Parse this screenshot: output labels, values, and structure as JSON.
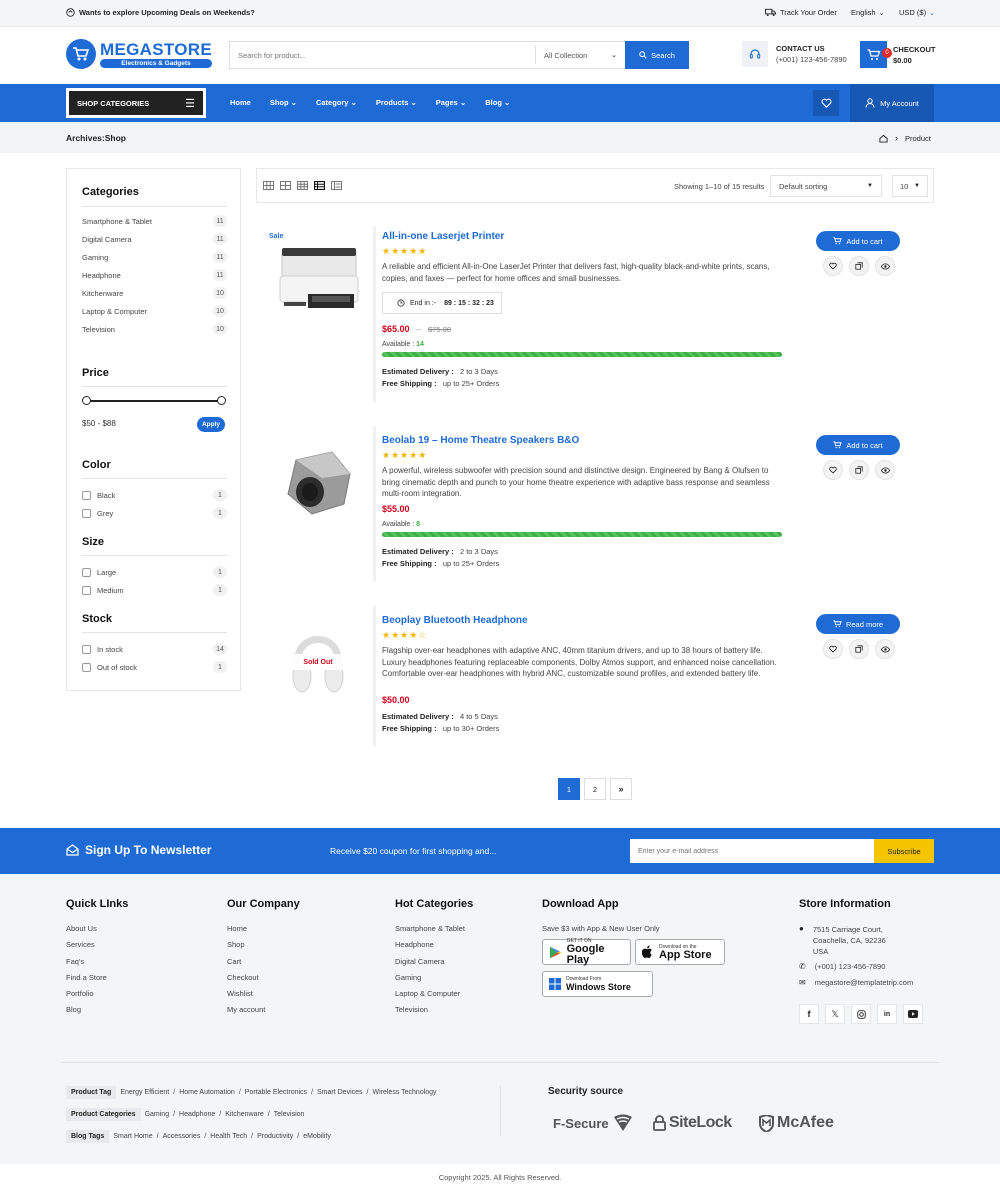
{
  "topbar": {
    "promo": "Wants to explore Upcoming Deals on Weekends?",
    "track": "Track Your Order",
    "language": "English",
    "currency": "USD ($)"
  },
  "header": {
    "logo_main_1": "MEGA",
    "logo_main_2": "STORE",
    "logo_sub": "Electronics & Gadgets",
    "search_placeholder": "Search for product...",
    "collection": "All Collection",
    "search_btn": "Search",
    "contact_label": "CONTACT US",
    "contact_phone": "(+001) 123-456-7890",
    "cart_count": "0",
    "checkout_label": "CHECKOUT",
    "checkout_total": "$0.00"
  },
  "nav": {
    "categories_btn": "SHOP CATEGORIES",
    "items": [
      "Home",
      "Shop",
      "Category",
      "Products",
      "Pages",
      "Blog"
    ],
    "account": "My Account"
  },
  "crumb": {
    "title": "Archives:Shop",
    "current": "Product"
  },
  "sidebar": {
    "categories_title": "Categories",
    "categories": [
      {
        "name": "Smartphone & Tablet",
        "count": "11"
      },
      {
        "name": "Digital Camera",
        "count": "11"
      },
      {
        "name": "Gaming",
        "count": "11"
      },
      {
        "name": "Headphone",
        "count": "11"
      },
      {
        "name": "Kitchenware",
        "count": "10"
      },
      {
        "name": "Laptop & Computer",
        "count": "10"
      },
      {
        "name": "Television",
        "count": "10"
      }
    ],
    "price_title": "Price",
    "price_range": "$50 - $88",
    "apply": "Apply",
    "price_slider": {
      "min": 50,
      "max": 88,
      "low": 50,
      "high": 88
    },
    "color_title": "Color",
    "colors": [
      {
        "name": "Black",
        "count": "1"
      },
      {
        "name": "Grey",
        "count": "1"
      }
    ],
    "size_title": "Size",
    "sizes": [
      {
        "name": "Large",
        "count": "1"
      },
      {
        "name": "Medium",
        "count": "1"
      }
    ],
    "stock_title": "Stock",
    "stock": [
      {
        "name": "In stock",
        "count": "14"
      },
      {
        "name": "Out of stock",
        "count": "1"
      }
    ]
  },
  "toolbar": {
    "results": "Showing 1–10 of 15 results",
    "sorting": "Default sorting",
    "per_page": "10"
  },
  "products": [
    {
      "badge": "Sale",
      "title": "All-in-one Laserjet Printer",
      "rating": 5,
      "desc": "A reliable and efficient All-in-One LaserJet Printer that delivers fast, high-quality black-and-white prints, scans, copies, and faxes — perfect for home offices and small businesses.",
      "timer_label": "End in :-",
      "timer": "89 : 15 : 32 : 23",
      "price": "$65.00",
      "old_price": "$75.00",
      "available_label": "Available :",
      "available": "14",
      "stock_fill": 1.0,
      "delivery_label": "Estimated Delivery :",
      "delivery": "2 to 3 Days",
      "shipping_label": "Free Shipping :",
      "shipping": "up to 25+ Orders",
      "action": "Add to cart"
    },
    {
      "title": "Beolab 19 – Home Theatre Speakers B&O",
      "rating": 5,
      "desc": "A powerful, wireless subwoofer with precision sound and distinctive design. Engineered by Bang & Olufsen to bring cinematic depth and punch to your home theatre experience with adaptive bass response and seamless multi-room integration.",
      "price": "$55.00",
      "available_label": "Available :",
      "available": "8",
      "stock_fill": 1.0,
      "delivery_label": "Estimated Delivery :",
      "delivery": "2 to 3 Days",
      "shipping_label": "Free Shipping :",
      "shipping": "up to 25+ Orders",
      "action": "Add to cart"
    },
    {
      "badge": "Sold Out",
      "title": "Beoplay Bluetooth Headphone",
      "rating": 4,
      "desc": "Flagship over-ear headphones with adaptive ANC, 40mm titanium drivers, and up to 38 hours of battery life. Luxury headphones featuring replaceable components, Dolby Atmos support, and enhanced noise cancellation. Comfortable over-ear headphones with hybrid ANC, customizable sound profiles, and extended battery life.",
      "price": "$50.00",
      "delivery_label": "Estimated Delivery :",
      "delivery": "4 to 5 Days",
      "shipping_label": "Free Shipping :",
      "shipping": "up to 30+ Orders",
      "action": "Read more"
    }
  ],
  "pagination": {
    "pages": [
      "1",
      "2"
    ],
    "next": "»"
  },
  "newsletter": {
    "title": "Sign Up To Newsletter",
    "offer": "Receive $20 coupon for first shopping and...",
    "placeholder": "Enter your e-mail address",
    "button": "Subscribe"
  },
  "footer": {
    "quick_title": "Quick LInks",
    "quick": [
      "About Us",
      "Services",
      "Faq's",
      "Find a Store",
      "Portfolio",
      "Blog"
    ],
    "company_title": "Our Company",
    "company": [
      "Home",
      "Shop",
      "Cart",
      "Checkout",
      "Wishlist",
      "My account"
    ],
    "hot_title": "Hot Categories",
    "hot": [
      "Smartphone & Tablet",
      "Headphone",
      "Digital Camera",
      "Gaming",
      "Laptop & Computer",
      "Television"
    ],
    "app_title": "Download App",
    "app_text": "Save $3 with App & New User Only",
    "gplay_small": "GET IT ON",
    "gplay_big": "Google Play",
    "appstore_small": "Download on the",
    "appstore_big": "App Store",
    "win_small": "Download From",
    "win_big": "Windows Store",
    "store_title": "Store Information",
    "address_1": "7515 Carriage Court,",
    "address_2": "Coachella, CA, 92236",
    "address_3": "USA",
    "phone": "(+001) 123-456-7890",
    "email": "megastore@templatetrip.com",
    "tags": [
      {
        "label": "Product Tag",
        "items": [
          "Energy Efficient",
          "Home Automation",
          "Portable Electronics",
          "Smart Devices",
          "Wireless Technology"
        ]
      },
      {
        "label": "Product Categories",
        "items": [
          "Gaming",
          "Headphone",
          "Kitchenware",
          "Television"
        ]
      },
      {
        "label": "Blog Tags",
        "items": [
          "Smart Home",
          "Accessories",
          "Health Tech",
          "Productivity",
          "eMobility"
        ]
      }
    ],
    "security_title": "Security source",
    "brand_1": "F-Secure",
    "brand_2": "SiteLock",
    "brand_3": "McAfee",
    "copyright": "Copyright 2025. All Rights Reserved."
  },
  "colors": {
    "primary": "#1e6bd6",
    "accent": "#f5c400",
    "sale_price": "#d0021b",
    "stock_bar": "#3fae45"
  }
}
